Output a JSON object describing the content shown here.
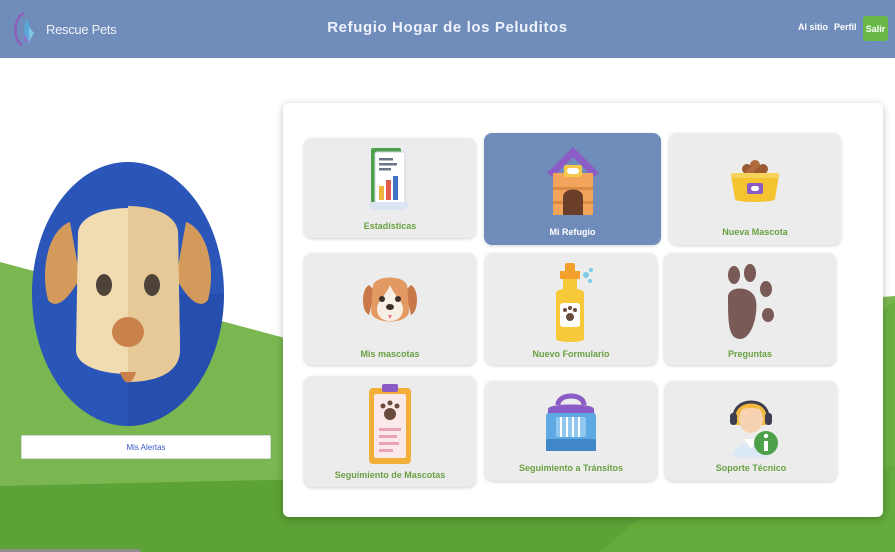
{
  "header": {
    "brand_name": "Rescue Pets",
    "title": "Refugio Hogar de los Peluditos",
    "nav": {
      "al_sitio": "Al sitio",
      "perfil": "Perfil",
      "salir": "Salir"
    }
  },
  "sidebar": {
    "alerts_label": "Mis Alertas"
  },
  "menu": {
    "cards": [
      {
        "label": "Estadísticas",
        "icon": "statistics-icon"
      },
      {
        "label": "Mi Refugio",
        "icon": "dog-house-icon",
        "active": true
      },
      {
        "label": "Nueva Mascota",
        "icon": "food-bowl-icon"
      },
      {
        "label": "Mis mascotas",
        "icon": "dog-face-icon"
      },
      {
        "label": "Nuevo Formulario",
        "icon": "shampoo-bottle-icon"
      },
      {
        "label": "Preguntas",
        "icon": "paw-print-icon"
      },
      {
        "label": "Seguimiento de Mascotas",
        "icon": "clipboard-paw-icon"
      },
      {
        "label": "Seguimiento a Tránsitos",
        "icon": "pet-carrier-icon"
      },
      {
        "label": "Soporte Técnico",
        "icon": "support-agent-icon"
      }
    ]
  },
  "colors": {
    "header_bg": "#6f8cbb",
    "accent_green": "#68b747",
    "card_bg": "#ececec",
    "card_active_bg": "#6f8cbb",
    "card_label": "#6aa043"
  }
}
